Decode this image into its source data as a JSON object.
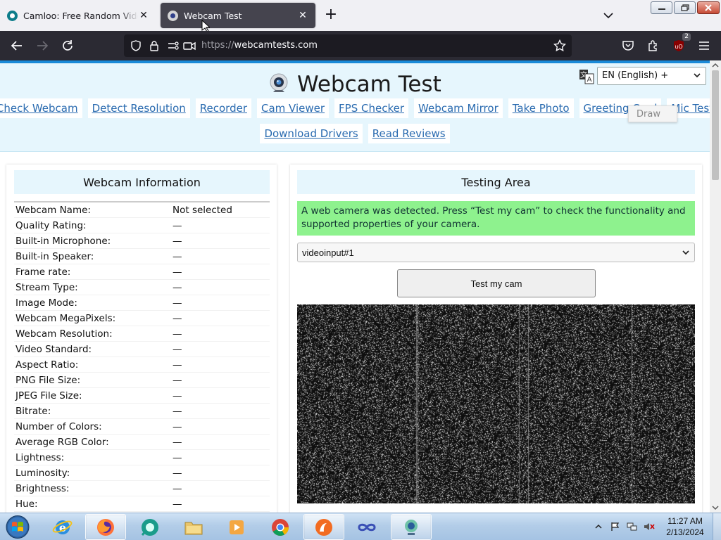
{
  "browser": {
    "tabs": [
      {
        "title": "Camloo: Free Random Video Chat",
        "active": false
      },
      {
        "title": "Webcam Test",
        "active": true
      }
    ],
    "url": {
      "protocol": "https://",
      "host": "webcamtests.com"
    },
    "extension_badge": "2"
  },
  "site": {
    "title": "Webcam Test",
    "language": "EN (English) +",
    "nav_row1": [
      "Check Webcam",
      "Detect Resolution",
      "Recorder",
      "Cam Viewer",
      "FPS Checker",
      "Webcam Mirror",
      "Take Photo",
      "Greeting Card",
      "Mic Test"
    ],
    "nav_row2": [
      "Download Drivers",
      "Read Reviews"
    ],
    "draw_popup": "Draw"
  },
  "webcam_info": {
    "title": "Webcam Information",
    "rows": [
      {
        "label": "Webcam Name:",
        "value": "Not selected"
      },
      {
        "label": "Quality Rating:",
        "value": "—"
      },
      {
        "label": "Built-in Microphone:",
        "value": "—"
      },
      {
        "label": "Built-in Speaker:",
        "value": "—"
      },
      {
        "label": "Frame rate:",
        "value": "—"
      },
      {
        "label": "Stream Type:",
        "value": "—"
      },
      {
        "label": "Image Mode:",
        "value": "—"
      },
      {
        "label": "Webcam MegaPixels:",
        "value": "—"
      },
      {
        "label": "Webcam Resolution:",
        "value": "—"
      },
      {
        "label": "Video Standard:",
        "value": "—"
      },
      {
        "label": "Aspect Ratio:",
        "value": "—"
      },
      {
        "label": "PNG File Size:",
        "value": "—"
      },
      {
        "label": "JPEG File Size:",
        "value": "—"
      },
      {
        "label": "Bitrate:",
        "value": "—"
      },
      {
        "label": "Number of Colors:",
        "value": "—"
      },
      {
        "label": "Average RGB Color:",
        "value": "—"
      },
      {
        "label": "Lightness:",
        "value": "—"
      },
      {
        "label": "Luminosity:",
        "value": "—"
      },
      {
        "label": "Brightness:",
        "value": "—"
      },
      {
        "label": "Hue:",
        "value": "—"
      }
    ]
  },
  "testing_area": {
    "title": "Testing Area",
    "alert": "A web camera was detected. Press “Test my cam” to check the functionality and supported properties of your camera.",
    "device": "videoinput#1",
    "button": "Test my cam"
  },
  "taskbar": {
    "apps": [
      "internet-explorer",
      "firefox",
      "camloo",
      "file-explorer",
      "media-player",
      "chrome",
      "avast",
      "infinity",
      "webcam-app"
    ],
    "time": "11:27 AM",
    "date": "2/13/2024"
  },
  "colors": {
    "accent": "#1a8ad8",
    "header_bg": "#e6f6fd",
    "link": "#2a6bb0",
    "alert_bg": "#8ef28e",
    "browser_dark": "#2b2a33"
  }
}
